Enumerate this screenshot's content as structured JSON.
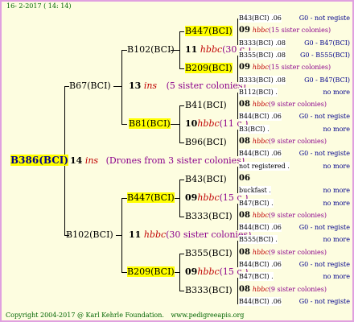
{
  "header": {
    "date": "16-  2-2017 ( 14: 14)"
  },
  "footer": {
    "copyright": "Copyright 2004-2017 @ Karl Kehrle Foundation.",
    "site": "www.pedigreeapis.org"
  },
  "root": {
    "id": "B386(BCI)",
    "num": "14",
    "ins": "ins",
    "note": "(Drones from 3 sister colonies)"
  },
  "gen1": [
    {
      "id": "B67(BCI)",
      "num": "13",
      "ins": "ins",
      "note": "(5 sister colonies)"
    },
    {
      "id": "B102(BCI)",
      "num": "11",
      "ins": "hbbc",
      "note": "(30 sister colonies)"
    }
  ],
  "gen2": [
    {
      "id": "B102(BCI)",
      "num": "11",
      "ins": "hbbc",
      "note": "(30 c.)"
    },
    {
      "id": "B81(BCI)",
      "num": "10",
      "ins": "hbbc",
      "note": "(11 c.)"
    },
    {
      "id": "B447(BCI)",
      "num": "09",
      "ins": "hbbc",
      "note": "(15 c.)"
    },
    {
      "id": "B209(BCI)",
      "num": "09",
      "ins": "hbbc",
      "note": "(15 c.)"
    }
  ],
  "gen3": [
    {
      "id": "B447(BCI)"
    },
    {
      "id": "B209(BCI)"
    },
    {
      "id": "B41(BCI)"
    },
    {
      "id": "B96(BCI)"
    },
    {
      "id": "B43(BCI)"
    },
    {
      "id": "B333(BCI)"
    },
    {
      "id": "B355(BCI)"
    },
    {
      "id": "B333(BCI)"
    }
  ],
  "gen4": [
    {
      "a": "B43(BCI) .06",
      "b": "G0 - not registe"
    },
    {
      "a": "09",
      "ins": "hbbc",
      "b": "(15 sister colonies)"
    },
    {
      "a": "B333(BCI) .08",
      "b": "G0 - B47(BCI)"
    },
    {
      "a": "B355(BCI) .08",
      "b": "G0 - B555(BCI)"
    },
    {
      "a": "09",
      "ins": "hbbc",
      "b": "(15 sister colonies)"
    },
    {
      "a": "B333(BCI) .08",
      "b": "G0 - B47(BCI)"
    },
    {
      "a": "B112(BCI) .",
      "b": "no more"
    },
    {
      "a": "08",
      "ins": "hbbc",
      "b": "(9 sister colonies)"
    },
    {
      "a": "B44(BCI) .06",
      "b": "G0 - not registe"
    },
    {
      "a": "B3(BCI) .",
      "b": "no more"
    },
    {
      "a": "08",
      "ins": "hbbc",
      "b": "(9 sister colonies)"
    },
    {
      "a": "B44(BCI) .06",
      "b": "G0 - not registe"
    },
    {
      "a": "not registered .",
      "b": "no more"
    },
    {
      "a": "06",
      "ins": "",
      "b": ""
    },
    {
      "a": "buckfast .",
      "b": "no more"
    },
    {
      "a": "B47(BCI) .",
      "b": "no more"
    },
    {
      "a": "08",
      "ins": "hbbc",
      "b": "(9 sister colonies)"
    },
    {
      "a": "B44(BCI) .06",
      "b": "G0 - not registe"
    },
    {
      "a": "B555(BCI) .",
      "b": "no more"
    },
    {
      "a": "08",
      "ins": "hbbc",
      "b": "(9 sister colonies)"
    },
    {
      "a": "B44(BCI) .06",
      "b": "G0 - not registe"
    },
    {
      "a": "B47(BCI) .",
      "b": "no more"
    },
    {
      "a": "08",
      "ins": "hbbc",
      "b": "(9 sister colonies)"
    },
    {
      "a": "B44(BCI) .06",
      "b": "G0 - not registe"
    }
  ]
}
